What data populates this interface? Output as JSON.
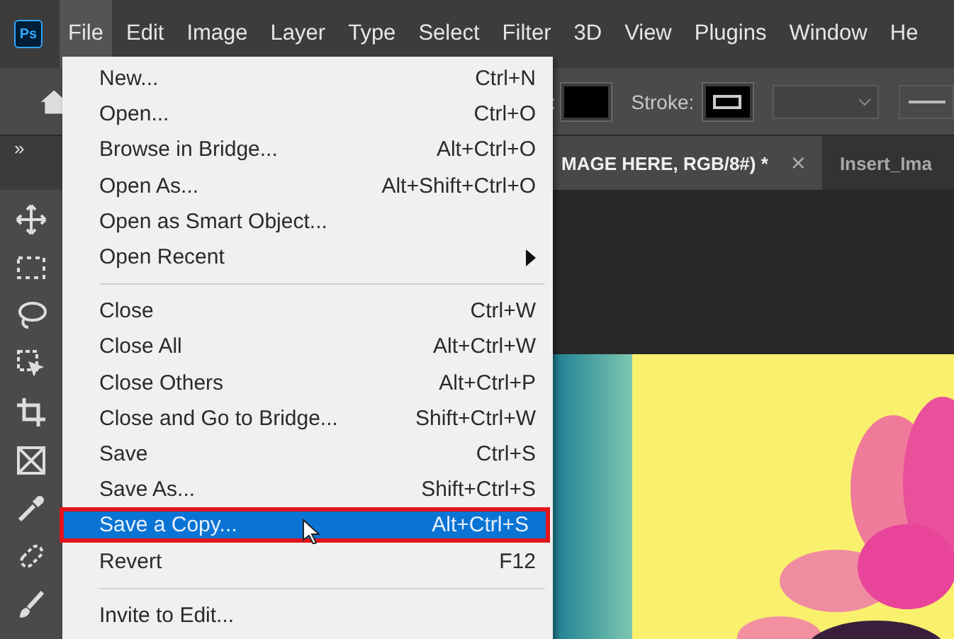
{
  "menubar": {
    "logo": "Ps",
    "items": [
      {
        "label": "File",
        "selected": true
      },
      {
        "label": "Edit",
        "selected": false
      },
      {
        "label": "Image",
        "selected": false
      },
      {
        "label": "Layer",
        "selected": false
      },
      {
        "label": "Type",
        "selected": false
      },
      {
        "label": "Select",
        "selected": false
      },
      {
        "label": "Filter",
        "selected": false
      },
      {
        "label": "3D",
        "selected": false
      },
      {
        "label": "View",
        "selected": false
      },
      {
        "label": "Plugins",
        "selected": false
      },
      {
        "label": "Window",
        "selected": false
      },
      {
        "label": "He",
        "selected": false
      }
    ]
  },
  "options_bar": {
    "fill_label": ":",
    "stroke_label": "Stroke:"
  },
  "panel_toggle": "»",
  "document_tabs": [
    {
      "label": "MAGE HERE, RGB/8#) *",
      "selected": true,
      "close": "×"
    },
    {
      "label": "Insert_Ima",
      "selected": false
    }
  ],
  "file_menu": {
    "groups": [
      [
        {
          "label": "New...",
          "shortcut": "Ctrl+N",
          "selected": false,
          "submenu": false,
          "highlighted_frame": false
        },
        {
          "label": "Open...",
          "shortcut": "Ctrl+O",
          "selected": false,
          "submenu": false,
          "highlighted_frame": false
        },
        {
          "label": "Browse in Bridge...",
          "shortcut": "Alt+Ctrl+O",
          "selected": false,
          "submenu": false,
          "highlighted_frame": false
        },
        {
          "label": "Open As...",
          "shortcut": "Alt+Shift+Ctrl+O",
          "selected": false,
          "submenu": false,
          "highlighted_frame": false
        },
        {
          "label": "Open as Smart Object...",
          "selected": false,
          "submenu": false,
          "highlighted_frame": false
        },
        {
          "label": "Open Recent",
          "selected": false,
          "submenu": true,
          "highlighted_frame": false
        }
      ],
      [
        {
          "label": "Close",
          "shortcut": "Ctrl+W",
          "selected": false,
          "submenu": false,
          "highlighted_frame": false
        },
        {
          "label": "Close All",
          "shortcut": "Alt+Ctrl+W",
          "selected": false,
          "submenu": false,
          "highlighted_frame": false
        },
        {
          "label": "Close Others",
          "shortcut": "Alt+Ctrl+P",
          "selected": false,
          "submenu": false,
          "highlighted_frame": false
        },
        {
          "label": "Close and Go to Bridge...",
          "shortcut": "Shift+Ctrl+W",
          "selected": false,
          "submenu": false,
          "highlighted_frame": false
        },
        {
          "label": "Save",
          "shortcut": "Ctrl+S",
          "selected": false,
          "submenu": false,
          "highlighted_frame": false
        },
        {
          "label": "Save As...",
          "shortcut": "Shift+Ctrl+S",
          "selected": false,
          "submenu": false,
          "highlighted_frame": false
        },
        {
          "label": "Save a Copy...",
          "shortcut": "Alt+Ctrl+S",
          "selected": true,
          "submenu": false,
          "highlighted_frame": true
        },
        {
          "label": "Revert",
          "shortcut": "F12",
          "selected": false,
          "submenu": false,
          "highlighted_frame": false
        }
      ],
      [
        {
          "label": "Invite to Edit...",
          "selected": false,
          "submenu": false,
          "highlighted_frame": false
        }
      ]
    ]
  }
}
